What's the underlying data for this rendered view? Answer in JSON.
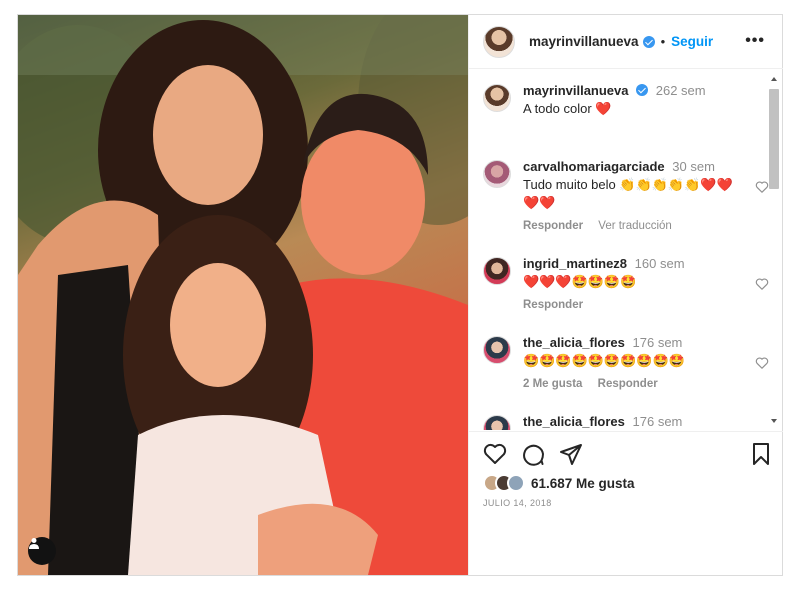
{
  "post": {
    "author": "mayrinvillanueva",
    "follow_label": "Seguir",
    "separator": "•",
    "more_label": "•••",
    "caption": {
      "user": "mayrinvillanueva",
      "time": "262 sem",
      "text": "A todo color",
      "emoji": "❤️"
    },
    "comments": [
      {
        "user": "carvalhomariagarciade",
        "time": "30 sem",
        "text": "Tudo muito belo 👏👏👏👏👏❤️❤️❤️❤️",
        "actions": [
          "Responder",
          "Ver traducción"
        ]
      },
      {
        "user": "ingrid_martinez8",
        "time": "160 sem",
        "text": "❤️❤️❤️🤩🤩🤩🤩",
        "actions": [
          "Responder"
        ]
      },
      {
        "user": "the_alicia_flores",
        "time": "176 sem",
        "text": "🤩🤩🤩🤩🤩🤩🤩🤩🤩🤩",
        "actions": [
          "2 Me gusta",
          "Responder"
        ]
      },
      {
        "user": "the_alicia_flores",
        "time": "176 sem",
        "text": "🤩🤩🤩🤩🤩🤩🤩🤩🤩🤩",
        "actions": []
      }
    ],
    "likes_text": "61.687 Me gusta",
    "date": "JULIO 14, 2018"
  },
  "icons": {
    "like": "heart-icon",
    "comment": "comment-icon",
    "share": "share-icon",
    "save": "bookmark-icon",
    "tag": "user-tag-icon",
    "verified": "verified-badge-icon"
  },
  "colors": {
    "link": "#0095f6",
    "verified": "#3897f0",
    "muted": "#8e8e8e"
  }
}
